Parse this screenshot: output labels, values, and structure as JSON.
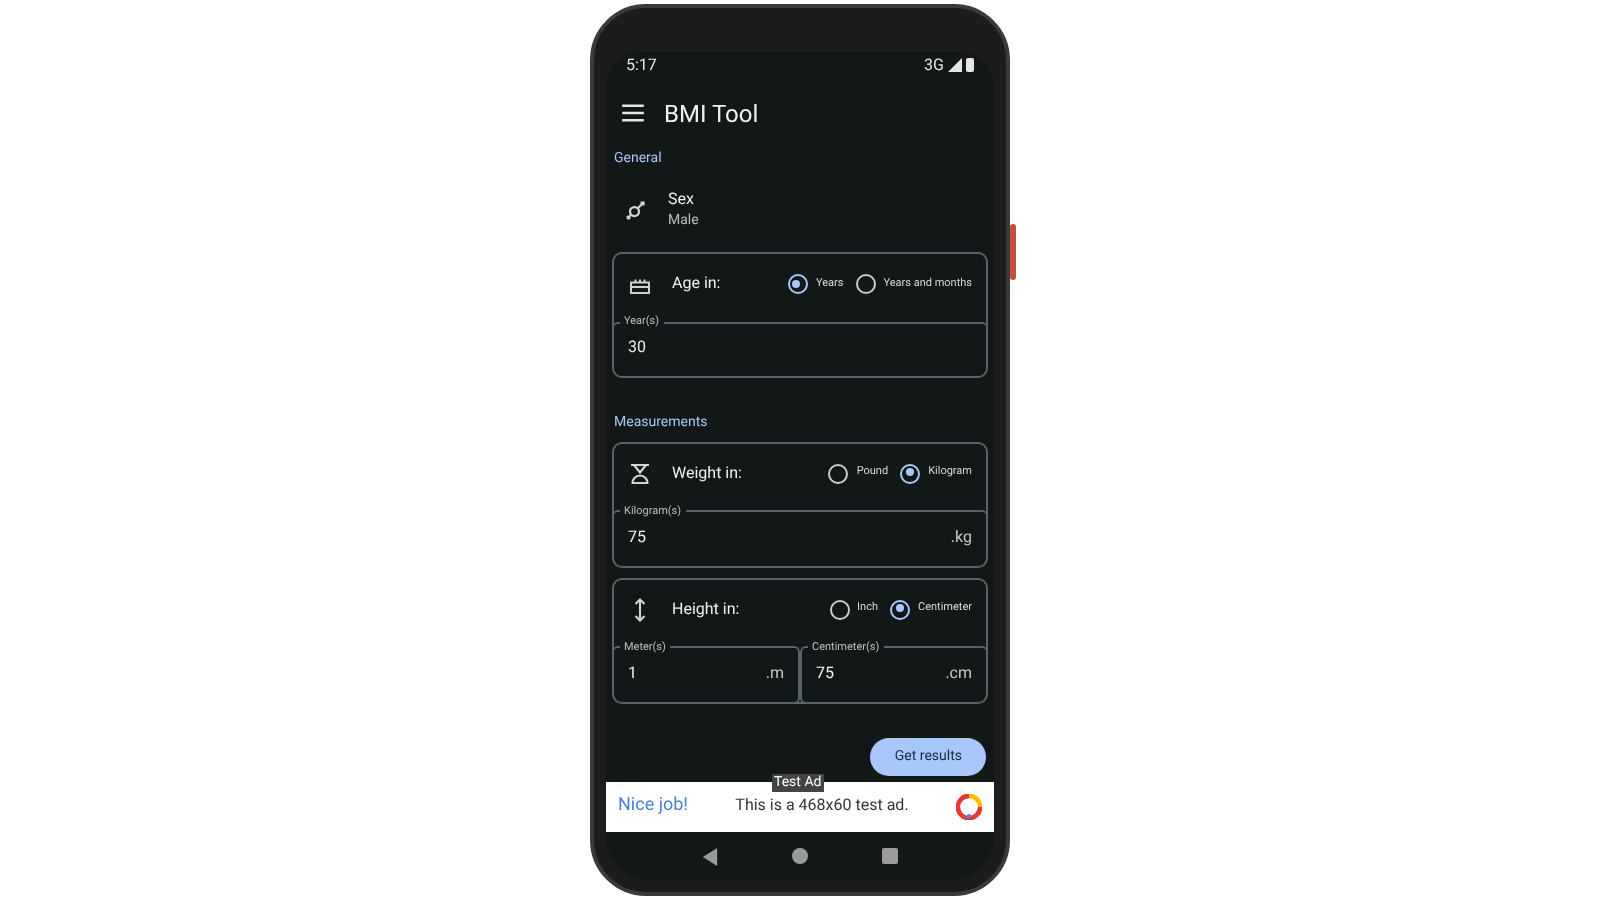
{
  "status_bar": {
    "time": "5:17",
    "network": "3G"
  },
  "app_bar": {
    "title": "BMI Tool"
  },
  "sections": [
    {
      "title": "General",
      "items": [
        {
          "kind": "setting",
          "label": "Sex",
          "value": "Male"
        },
        {
          "kind": "unit_group",
          "label": "Age in:",
          "options": [
            {
              "label": "Years",
              "selected": true
            },
            {
              "label": "Years and months",
              "selected": false
            }
          ],
          "fields": [
            {
              "label": "Year(s)",
              "value": "30"
            }
          ]
        }
      ]
    },
    {
      "title": "Measurements",
      "items": [
        {
          "kind": "unit_group",
          "label": "Weight in:",
          "options": [
            {
              "label": "Pound",
              "selected": false
            },
            {
              "label": "Kilogram",
              "selected": true
            }
          ],
          "fields": [
            {
              "label": "Kilogram(s)",
              "value": "75",
              "suffix": ".kg"
            }
          ]
        },
        {
          "kind": "unit_group",
          "label": "Height in:",
          "options": [
            {
              "label": "Inch",
              "selected": false
            },
            {
              "label": "Centimeter",
              "selected": true
            }
          ],
          "fields": [
            {
              "label": "Meter(s)",
              "value": "1",
              "suffix": ".m"
            },
            {
              "label": "Centimeter(s)",
              "value": "75",
              "suffix": ".cm"
            }
          ]
        }
      ]
    }
  ],
  "action_button": "Get results",
  "ad": {
    "tag": "Test Ad",
    "headline": "Nice job!",
    "text": "This is a 468x60 test ad."
  }
}
